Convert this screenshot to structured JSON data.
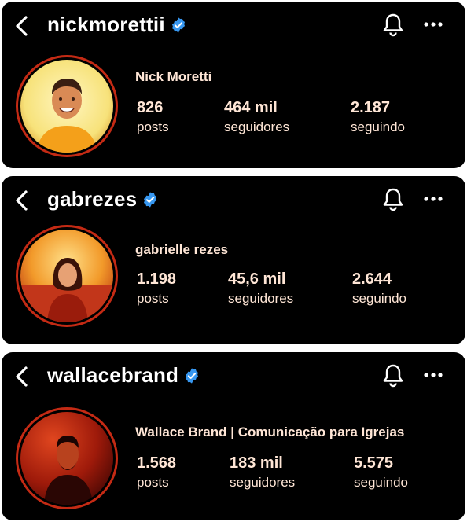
{
  "profiles": [
    {
      "username": "nickmorettii",
      "full_name": "Nick Moretti",
      "stats": [
        {
          "value": "826",
          "label": "posts"
        },
        {
          "value": "464 mil",
          "label": "seguidores"
        },
        {
          "value": "2.187",
          "label": "seguindo"
        }
      ]
    },
    {
      "username": "gabrezes",
      "full_name": "gabrielle rezes",
      "stats": [
        {
          "value": "1.198",
          "label": "posts"
        },
        {
          "value": "45,6 mil",
          "label": "seguidores"
        },
        {
          "value": "2.644",
          "label": "seguindo"
        }
      ]
    },
    {
      "username": "wallacebrand",
      "full_name": "Wallace Brand | Comunicação para Igrejas",
      "stats": [
        {
          "value": "1.568",
          "label": "posts"
        },
        {
          "value": "183 mil",
          "label": "seguidores"
        },
        {
          "value": "5.575",
          "label": "seguindo"
        }
      ]
    }
  ],
  "icons": {
    "back": "chevron-left-icon",
    "verified": "verified-badge-icon",
    "notifications": "bell-icon",
    "more": "more-options-icon"
  },
  "colors": {
    "background": "#000000",
    "text": "#ffffff",
    "stat_text": "#ffe6d6",
    "verified": "#3797f0",
    "avatar_ring": "#c42a14"
  }
}
